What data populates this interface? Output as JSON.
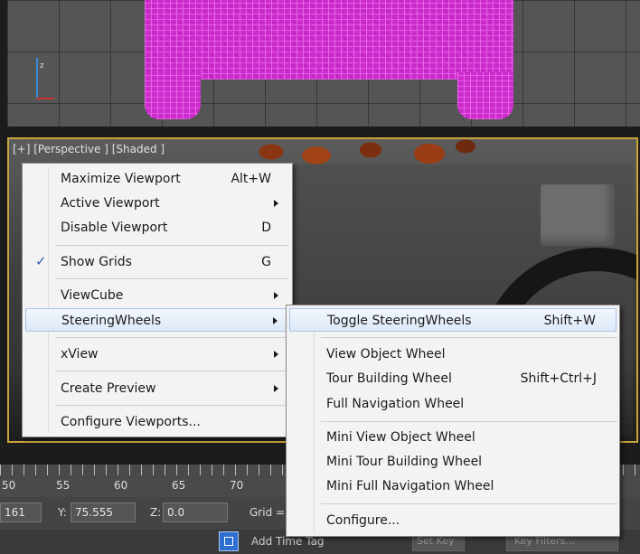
{
  "viewport": {
    "label": "[+] [Perspective ] [Shaded ]",
    "axis_label": "z"
  },
  "timeline": {
    "ruler_numbers": [
      "50",
      "55",
      "60",
      "65",
      "70"
    ]
  },
  "status_bar": {
    "x_value": "161",
    "y_label": "Y:",
    "y_value": "75.555",
    "z_label": "Z:",
    "z_value": "0.0",
    "grid_label": "Grid =",
    "add_time_tag": "Add Time Tag",
    "set_key": "Set Key",
    "key_filters": "Key Filters..."
  },
  "context_menu": {
    "items": [
      {
        "label": "Maximize Viewport",
        "shortcut": "Alt+W"
      },
      {
        "label": "Active Viewport",
        "submenu": true
      },
      {
        "label": "Disable Viewport",
        "shortcut": "D"
      },
      {
        "label": "Show Grids",
        "shortcut": "G",
        "checked": true
      },
      {
        "label": "ViewCube",
        "submenu": true
      },
      {
        "label": "SteeringWheels",
        "submenu": true,
        "highlighted": true
      },
      {
        "label": "xView",
        "submenu": true
      },
      {
        "label": "Create Preview",
        "submenu": true
      },
      {
        "label": "Configure Viewports..."
      }
    ]
  },
  "submenu": {
    "items": [
      {
        "label": "Toggle SteeringWheels",
        "shortcut": "Shift+W",
        "highlighted": true
      },
      {
        "label": "View Object Wheel"
      },
      {
        "label": "Tour Building Wheel",
        "shortcut": "Shift+Ctrl+J"
      },
      {
        "label": "Full Navigation Wheel"
      },
      {
        "label": "Mini View Object Wheel"
      },
      {
        "label": "Mini Tour Building Wheel"
      },
      {
        "label": "Mini Full Navigation Wheel"
      },
      {
        "label": "Configure..."
      }
    ]
  },
  "colors": {
    "mesh": "#cc2ccc",
    "viewport_border": "#c9a43a",
    "menu_bg": "#f3f3f3",
    "highlight": "#dde9f8"
  }
}
